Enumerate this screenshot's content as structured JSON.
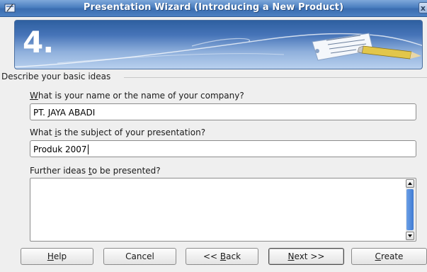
{
  "window": {
    "title": "Presentation Wizard (Introducing a New Product)",
    "close_glyph": "x"
  },
  "banner": {
    "step_number": "4."
  },
  "group": {
    "title": "Describe your basic ideas"
  },
  "fields": {
    "name_label_pre": "",
    "name_label_mnemonic": "W",
    "name_label_post": "hat is your name or the name of your company?",
    "name_value": "PT. JAYA ABADI",
    "subject_label_pre": "What ",
    "subject_label_mnemonic": "i",
    "subject_label_post": "s the subject of your presentation?",
    "subject_value": "Produk 2007",
    "ideas_label_pre": "Further ideas ",
    "ideas_label_mnemonic": "t",
    "ideas_label_post": "o be presented?",
    "ideas_value": ""
  },
  "buttons": {
    "help_mnemonic": "H",
    "help_rest": "elp",
    "cancel": "Cancel",
    "back_pre": "<< ",
    "back_mnemonic": "B",
    "back_rest": "ack",
    "next_mnemonic": "N",
    "next_rest": "ext >>",
    "create_mnemonic": "C",
    "create_rest": "reate"
  },
  "colors": {
    "titlebar": "#4b7fc0",
    "banner_top": "#2e5fa0",
    "scroll_thumb": "#3f7bd3"
  }
}
